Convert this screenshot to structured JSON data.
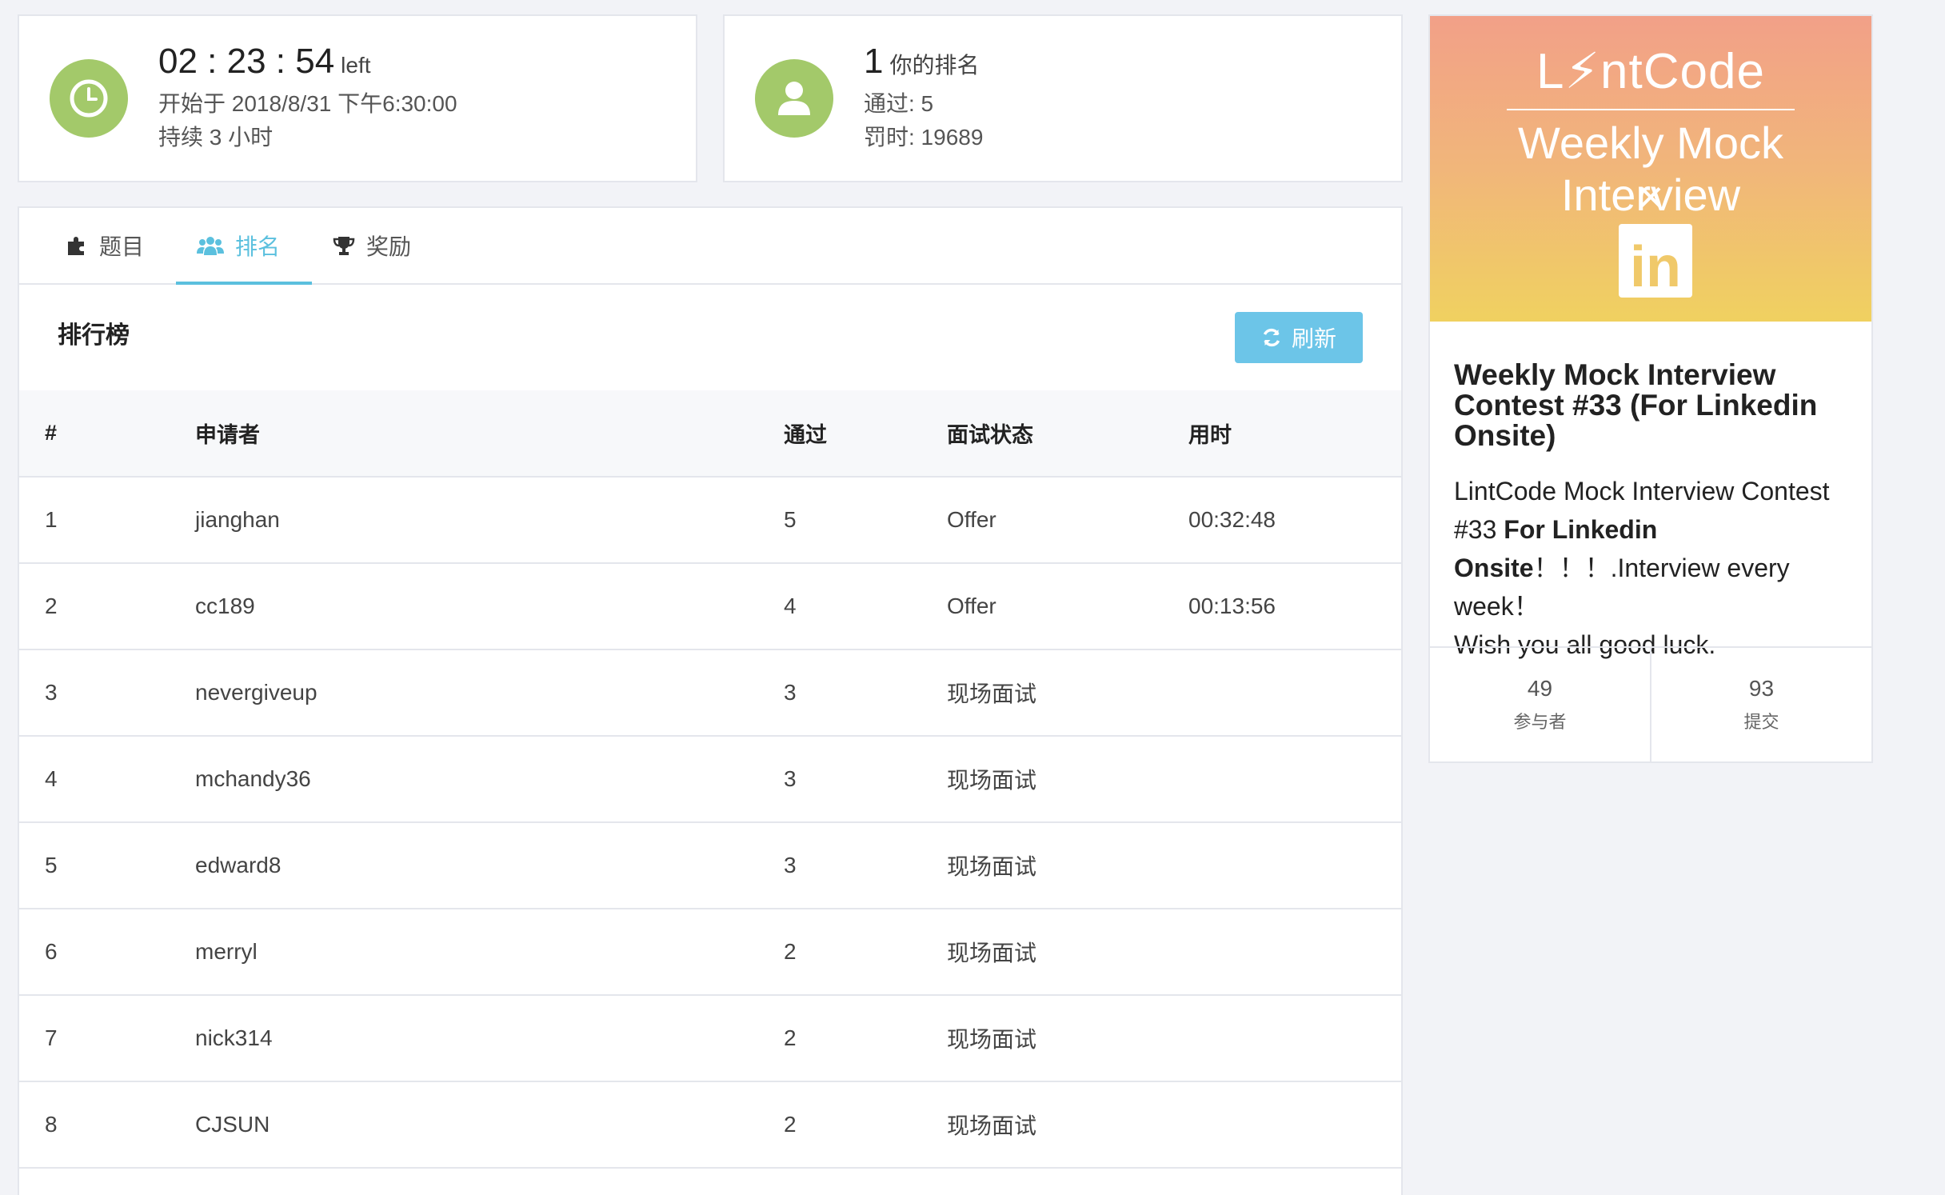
{
  "timer": {
    "remaining": "02 : 23 : 54",
    "remaining_suffix": "left",
    "start_time": "开始于 2018/8/31 下午6:30:00",
    "duration": "持续 3 小时"
  },
  "rank_summary": {
    "rank": "1",
    "rank_label": "你的排名",
    "passed": "通过: 5",
    "penalty": "罚时: 19689"
  },
  "tabs": [
    {
      "label": "题目",
      "icon": "puzzle-icon",
      "active": false
    },
    {
      "label": "排名",
      "icon": "users-icon",
      "active": true
    },
    {
      "label": "奖励",
      "icon": "trophy-icon",
      "active": false
    }
  ],
  "leaderboard": {
    "title": "排行榜",
    "refresh_label": "刷新",
    "columns": [
      "#",
      "申请者",
      "通过",
      "面试状态",
      "用时"
    ],
    "rows": [
      {
        "rank": "1",
        "name": "jianghan",
        "passed": "5",
        "status": "Offer",
        "time": "00:32:48"
      },
      {
        "rank": "2",
        "name": "cc189",
        "passed": "4",
        "status": "Offer",
        "time": "00:13:56"
      },
      {
        "rank": "3",
        "name": "nevergiveup",
        "passed": "3",
        "status": "现场面试",
        "time": ""
      },
      {
        "rank": "4",
        "name": "mchandy36",
        "passed": "3",
        "status": "现场面试",
        "time": ""
      },
      {
        "rank": "5",
        "name": "edward8",
        "passed": "3",
        "status": "现场面试",
        "time": ""
      },
      {
        "rank": "6",
        "name": "merryl",
        "passed": "2",
        "status": "现场面试",
        "time": ""
      },
      {
        "rank": "7",
        "name": "nick314",
        "passed": "2",
        "status": "现场面试",
        "time": ""
      },
      {
        "rank": "8",
        "name": "CJSUN",
        "passed": "2",
        "status": "现场面试",
        "time": ""
      }
    ]
  },
  "contest": {
    "banner_logo": "L⚡ntCode",
    "banner_title": "Weekly Mock Interview",
    "banner_x": "×",
    "banner_li": "in",
    "title": "Weekly Mock Interview Contest #33 (For Linkedin Onsite)",
    "desc_part1": "LintCode Mock Interview Contest #33 ",
    "desc_bold": "For Linkedin Onsite",
    "desc_part2": "！！！.Interview every week！",
    "desc_part3": "Wish you all good luck.",
    "participants": "49",
    "participants_label": "参与者",
    "submissions": "93",
    "submissions_label": "提交"
  },
  "colors": {
    "accent": "#5bc0de",
    "refresh_button": "#6cc5e8",
    "icon_circle": "#a3c96a",
    "banner_top": "#f2a088",
    "banner_bottom": "#f0d160"
  }
}
